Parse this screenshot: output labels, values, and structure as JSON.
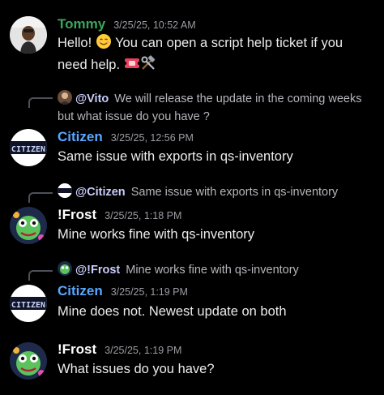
{
  "colors": {
    "background": "#000000",
    "tommy": "#3ba55c",
    "citizen": "#5aa7ff",
    "frost": "#ffffff",
    "vito_mention": "#c9cdfb",
    "timestamp": "#9b9ca3"
  },
  "messages": [
    {
      "author": "Tommy",
      "time": "3/25/25, 10:52 AM",
      "text": "Hello! 😊 You can open a script help ticket if you need help.",
      "emojis": [
        "smiling-face-emoji",
        "ticket-emoji",
        "hammer-wrench-emoji"
      ]
    },
    {
      "reply_to": "@Vito",
      "reply_text": "We will release the update in the coming weeks but what issue do you have ?",
      "author": "Citizen",
      "time": "3/25/25, 12:56 PM",
      "text": "Same issue with exports in qs-inventory",
      "avatar_text": "CITIZEN"
    },
    {
      "reply_to": "@Citizen",
      "reply_text": "Same issue with exports in qs-inventory",
      "author": "!Frost",
      "time": "3/25/25, 1:18 PM",
      "text": "Mine works fine with qs-inventory"
    },
    {
      "reply_to": "@!Frost",
      "reply_text": "Mine works fine with qs-inventory",
      "author": "Citizen",
      "time": "3/25/25, 1:19 PM",
      "text": "Mine does not. Newest update on both",
      "avatar_text": "CITIZEN"
    },
    {
      "author": "!Frost",
      "time": "3/25/25, 1:19 PM",
      "text": "What issues do you have?"
    }
  ]
}
